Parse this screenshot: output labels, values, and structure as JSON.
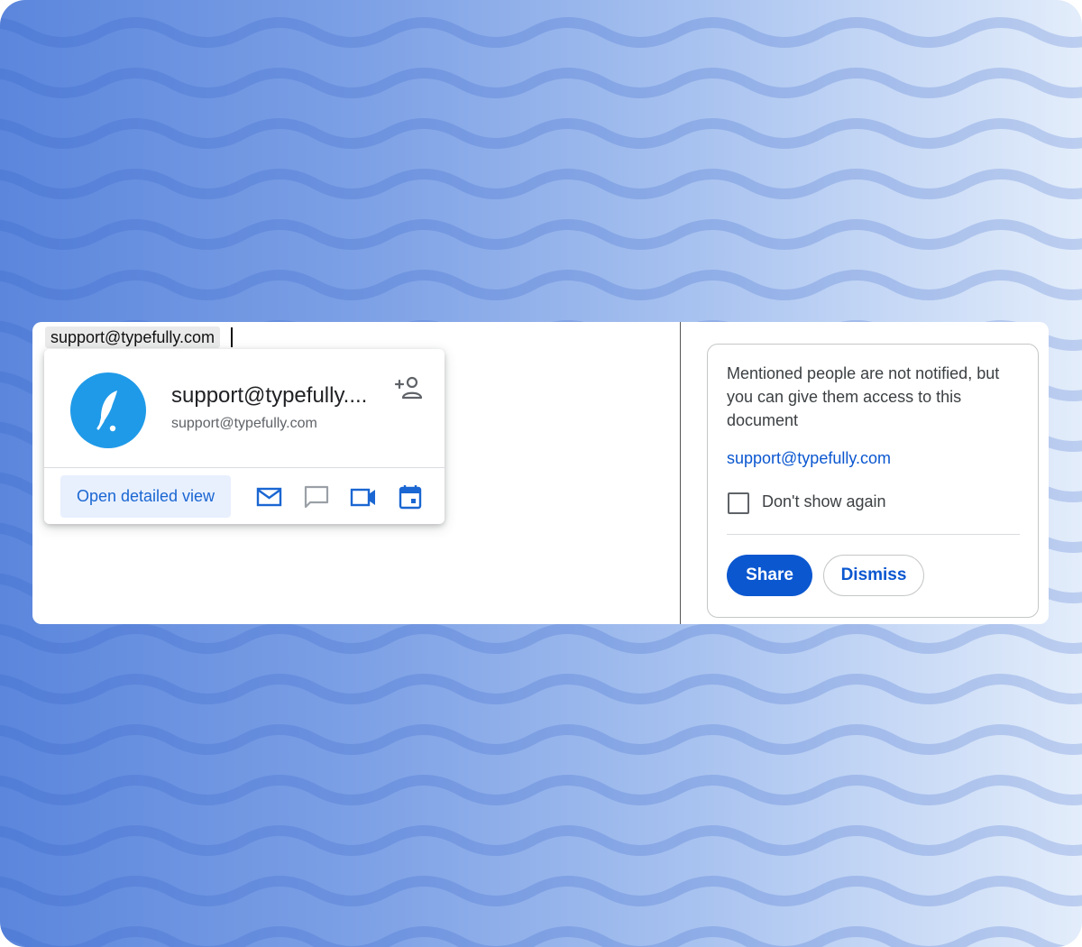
{
  "editor": {
    "mention_chip": "support@typefully.com"
  },
  "person_card": {
    "name": "support@typefully....",
    "email": "support@typefully.com",
    "open_detailed_view": "Open detailed view",
    "icons": {
      "add_person": "person-add-icon",
      "email": "mail-icon",
      "chat": "chat-icon",
      "video": "video-call-icon",
      "calendar": "calendar-icon"
    },
    "avatar_icon": "feather-logo-icon"
  },
  "share_prompt": {
    "message": "Mentioned people are not notified, but you can give them access to this document",
    "link": "support@typefully.com",
    "checkbox_label": "Don't show again",
    "checkbox_checked": false,
    "share_label": "Share",
    "dismiss_label": "Dismiss"
  },
  "colors": {
    "primary": "#0b57d0",
    "avatar": "#1f9ae8",
    "open_view_bg": "#e8f0fe"
  }
}
